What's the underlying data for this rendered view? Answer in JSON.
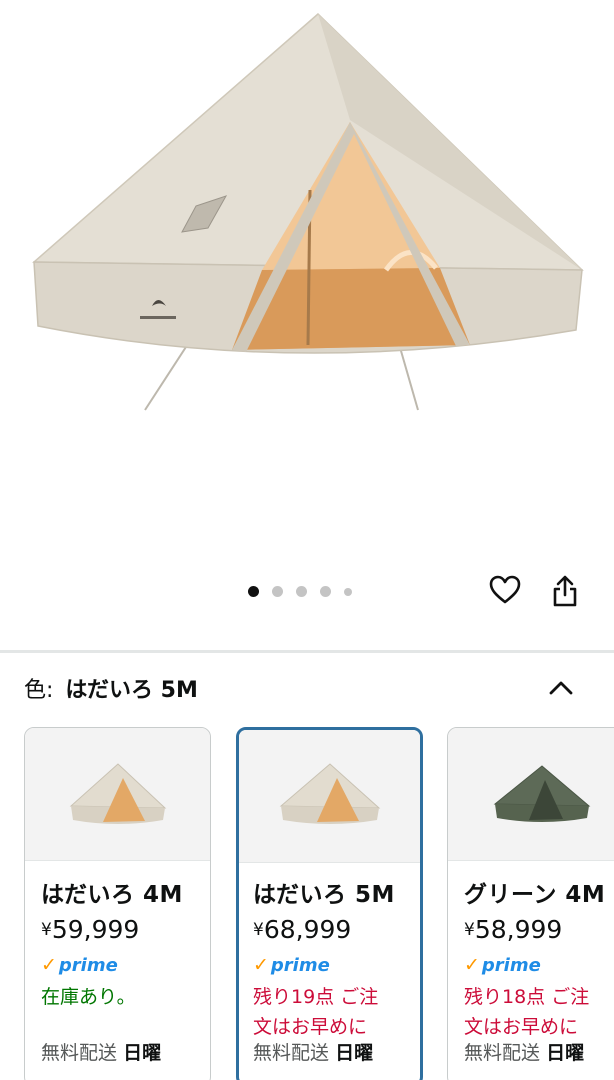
{
  "gallery": {
    "dot_count": 5,
    "active_index": 0
  },
  "color_selector": {
    "label": "色:",
    "selected_value": "はだいろ 5M"
  },
  "variants": [
    {
      "name": "はだいろ 4M",
      "currency": "¥",
      "price": "59,999",
      "prime_label": "prime",
      "stock": "在庫あり。",
      "stock_cont": "",
      "shipping_label": "無料配送",
      "shipping_day": "日曜",
      "selected": false
    },
    {
      "name": "はだいろ 5M",
      "currency": "¥",
      "price": "68,999",
      "prime_label": "prime",
      "stock": "残り19点 ご注",
      "stock_cont": "文はお早めに",
      "shipping_label": "無料配送",
      "shipping_day": "日曜",
      "selected": true
    },
    {
      "name": "グリーン 4M",
      "currency": "¥",
      "price": "58,999",
      "prime_label": "prime",
      "stock": "残り18点 ご注",
      "stock_cont": "文はお早めに",
      "shipping_label": "無料配送",
      "shipping_day": "日曜",
      "selected": false
    }
  ],
  "colors": {
    "link_blue": "#2f6f9f",
    "prime_blue": "#1f8ce6",
    "prime_check": "#ff9900",
    "in_stock_green": "#007600",
    "low_stock_red": "#cc0c39"
  },
  "icons": [
    "heart-icon",
    "share-icon",
    "chevron-up-icon",
    "prime-check-icon"
  ]
}
